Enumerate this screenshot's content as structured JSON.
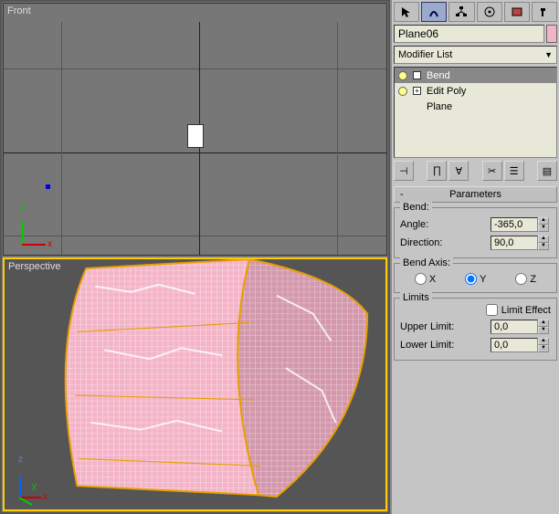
{
  "viewports": {
    "front": {
      "label": "Front",
      "axis_x": "x",
      "axis_y": "y"
    },
    "perspective": {
      "label": "Perspective",
      "axis_x": "x",
      "axis_y": "y"
    }
  },
  "panel": {
    "object_name": "Plane06",
    "object_color": "#f4b4c8",
    "modifier_list_placeholder": "Modifier List",
    "stack": [
      {
        "label": "Bend",
        "visible": true,
        "expandable": true,
        "selected": true
      },
      {
        "label": "Edit Poly",
        "visible": true,
        "expandable": true,
        "selected": false
      },
      {
        "label": "Plane",
        "visible": true,
        "expandable": false,
        "selected": false
      }
    ],
    "rollout_title": "Parameters",
    "bend": {
      "group_label": "Bend:",
      "angle_label": "Angle:",
      "angle_value": "-365,0",
      "direction_label": "Direction:",
      "direction_value": "90,0"
    },
    "bend_axis": {
      "group_label": "Bend Axis:",
      "options": [
        "X",
        "Y",
        "Z"
      ],
      "selected": "Y"
    },
    "limits": {
      "group_label": "Limits",
      "limit_effect_label": "Limit Effect",
      "limit_effect_checked": false,
      "upper_label": "Upper Limit:",
      "upper_value": "0,0",
      "lower_label": "Lower Limit:",
      "lower_value": "0,0"
    }
  }
}
